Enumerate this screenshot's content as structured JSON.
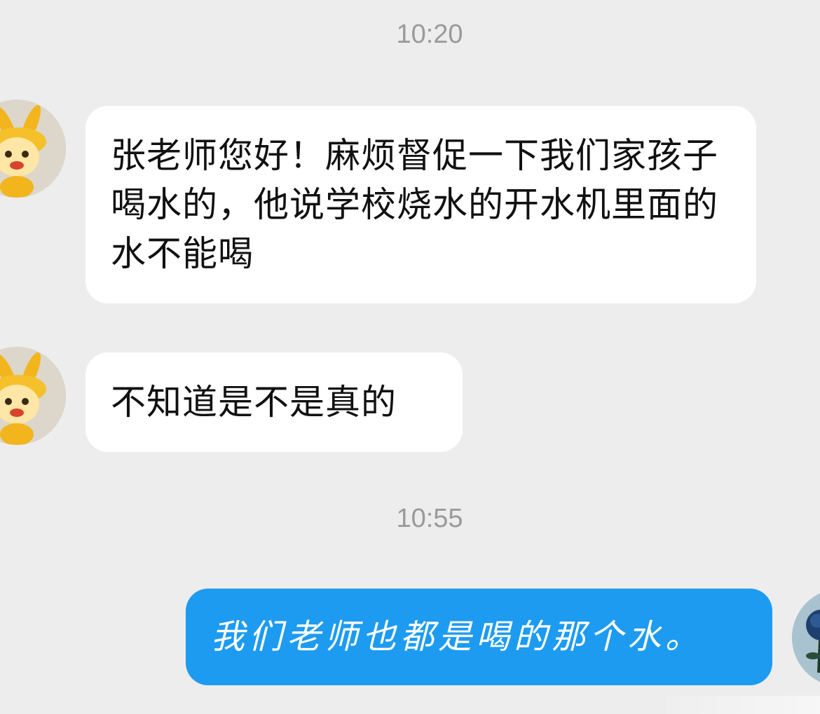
{
  "chat": {
    "timestamps": [
      "10:20",
      "10:55"
    ],
    "messages": [
      {
        "direction": "incoming",
        "text": "张老师您好！麻烦督促一下我们家孩子喝水的，他说学校烧水的开水机里面的水不能喝"
      },
      {
        "direction": "incoming",
        "text": "不知道是不是真的"
      },
      {
        "direction": "outgoing",
        "text": "我们老师也都是喝的那个水。"
      }
    ],
    "avatars": {
      "contact_icon": "golden-bunny-avatar-icon",
      "self_icon": "blue-rose-avatar-icon"
    }
  },
  "colors": {
    "background": "#ededed",
    "incoming_bubble": "#ffffff",
    "outgoing_bubble": "#1d9bf0",
    "timestamp_text": "#9a9a9a"
  }
}
